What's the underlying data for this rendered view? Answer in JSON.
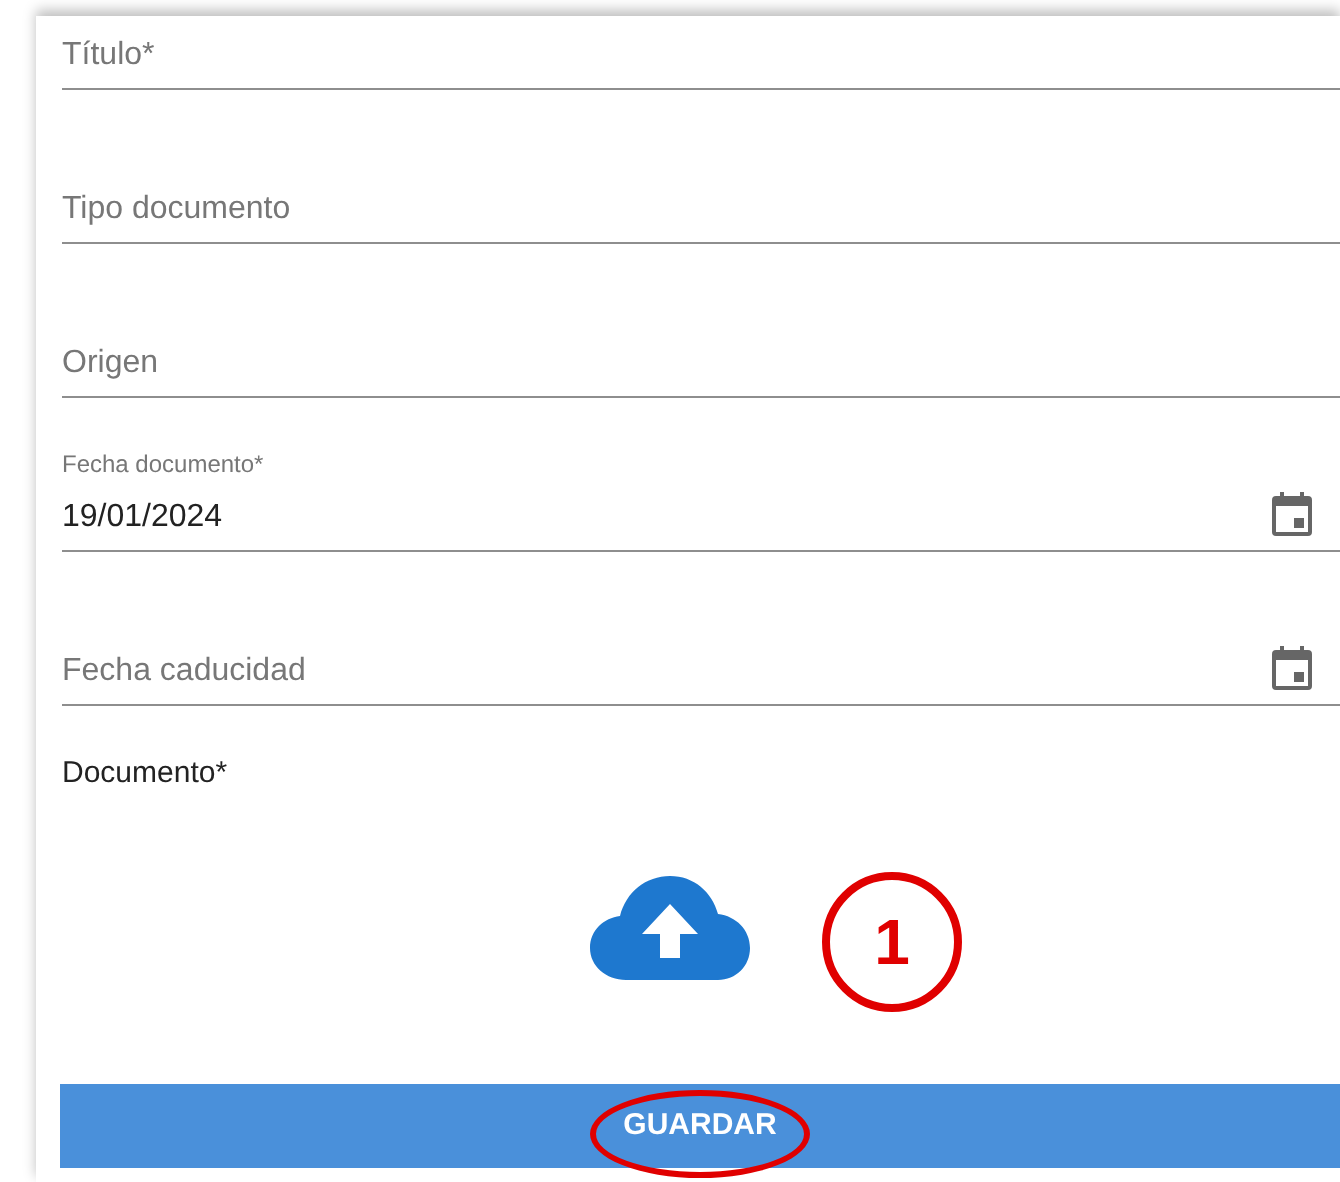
{
  "fields": [
    {
      "kind": "text",
      "label": "Título*"
    },
    {
      "kind": "text",
      "label": "Tipo documento"
    },
    {
      "kind": "text",
      "label": "Origen"
    },
    {
      "kind": "date",
      "label": "Fecha documento*",
      "value": "19/01/2024"
    },
    {
      "kind": "date",
      "label": "Fecha caducidad"
    }
  ],
  "upload": {
    "label": "Documento*"
  },
  "save_button": {
    "label": "GUARDAR"
  },
  "annotations": [
    {
      "kind": "numbered_circle",
      "text": "1"
    },
    {
      "kind": "ellipse"
    }
  ]
}
